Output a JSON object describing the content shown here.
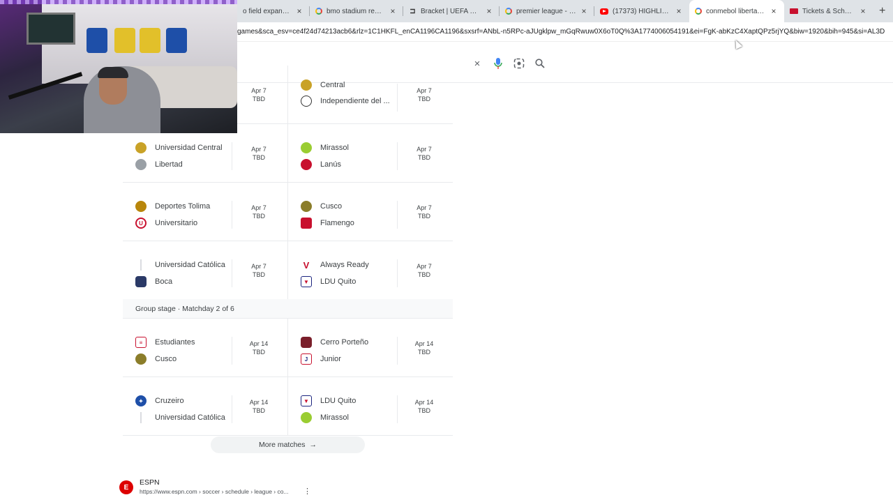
{
  "browser": {
    "tabs": [
      {
        "label": "o field expansion",
        "favicon": "generic-icon",
        "active": false
      },
      {
        "label": "bmo stadium remode",
        "favicon": "google-icon",
        "active": false
      },
      {
        "label": "Bracket | UEFA Cham",
        "favicon": "bracket-icon",
        "active": false
      },
      {
        "label": "premier league - Goc",
        "favicon": "google-icon",
        "active": false
      },
      {
        "label": "(17373) HIGHLIGHTS",
        "favicon": "youtube-icon",
        "active": false
      },
      {
        "label": "conmebol libertador",
        "favicon": "google-icon",
        "active": true
      },
      {
        "label": "Tickets & Schedule |",
        "favicon": "tickets-icon",
        "active": false
      }
    ],
    "new_tab": "+",
    "close_glyph": "×",
    "url": "games&sca_esv=ce4f24d74213acb6&rlz=1C1HKFL_enCA1196CA1196&sxsrf=ANbL-n5RPc-aJUgklpw_mGqRwuw0X6oT0Q%3A1774006054191&ei=FgK-abKzC4XaptQPz5rjYQ&biw=1920&bih=945&si=AL3D"
  },
  "search": {
    "clear_icon": "×",
    "mic_icon": "🎙",
    "lens_icon": "⌾",
    "search_icon": "⌕"
  },
  "matches_top": [
    {
      "t1": "Central",
      "t1_color": "#c9a227",
      "t2": "Independiente del ...",
      "t2_color": "#222222",
      "date": "Apr 7",
      "time": "TBD",
      "side": "right"
    }
  ],
  "rows": [
    {
      "left": {
        "t1": "Universidad Central",
        "c1": "#c9a227",
        "t2": "Libertad",
        "c2": "#9aa0a6",
        "date": "Apr 7",
        "time": "TBD"
      },
      "right": {
        "t1": "Mirassol",
        "c1": "#9acd32",
        "t2": "Lanús",
        "c2": "#c8102e",
        "date": "Apr 7",
        "time": "TBD"
      }
    },
    {
      "left": {
        "t1": "Deportes Tolima",
        "c1": "#b8860b",
        "t2": "Universitario",
        "c2": "#c8102e",
        "date": "Apr 7",
        "time": "TBD"
      },
      "right": {
        "t1": "Cusco",
        "c1": "#8b7d2a",
        "t2": "Flamengo",
        "c2": "#c8102e",
        "date": "Apr 7",
        "time": "TBD"
      }
    },
    {
      "left": {
        "t1": "Universidad Católica",
        "c1": "#dadce0",
        "t2": "Boca",
        "c2": "#2b3a67",
        "date": "Apr 7",
        "time": "TBD"
      },
      "right": {
        "t1": "Always Ready",
        "c1": "#c8102e",
        "t2": "LDU Quito",
        "c2": "#1a237e",
        "date": "Apr 7",
        "time": "TBD"
      }
    }
  ],
  "stage_label": "Group stage · Matchday 2 of 6",
  "rows2": [
    {
      "left": {
        "t1": "Estudiantes",
        "c1": "#c8102e",
        "t2": "Cusco",
        "c2": "#8b7d2a",
        "date": "Apr 14",
        "time": "TBD"
      },
      "right": {
        "t1": "Cerro Porteño",
        "c1": "#7a1f2b",
        "t2": "Junior",
        "c2": "#c8102e",
        "date": "Apr 14",
        "time": "TBD"
      }
    },
    {
      "left": {
        "t1": "Cruzeiro",
        "c1": "#1e4fa8",
        "t2": "Universidad Católica",
        "c2": "#dadce0",
        "date": "Apr 14",
        "time": "TBD"
      },
      "right": {
        "t1": "LDU Quito",
        "c1": "#1a237e",
        "t2": "Mirassol",
        "c2": "#9acd32",
        "date": "Apr 14",
        "time": "TBD"
      }
    }
  ],
  "more_matches": "More matches",
  "more_arrow": "→",
  "result": {
    "source": "ESPN",
    "logo_glyph": "E",
    "url": "https://www.espn.com › soccer › schedule › league › co...",
    "menu": "⋮"
  }
}
